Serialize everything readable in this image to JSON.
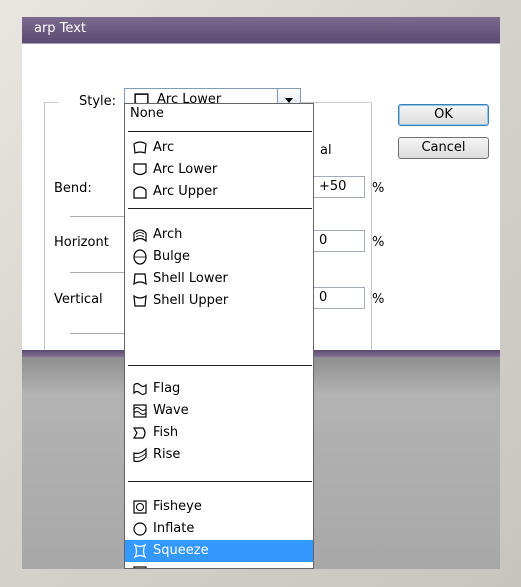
{
  "dialog": {
    "title": "arp Text",
    "style_label": "Style:",
    "style_value": "Arc Lower",
    "ok_label": "OK",
    "cancel_label": "Cancel",
    "radio_fragment": "(",
    "radio_fragment_right": "al",
    "bend_label": "Bend:",
    "bend_value": "+50",
    "horizontal_label": "Horizont",
    "horizontal_value": "0",
    "vertical_label": "Vertical",
    "vertical_value": "0",
    "percent": "%"
  },
  "dropdown": {
    "none_label": "None",
    "groups": [
      [
        {
          "label": "Arc",
          "icon": "arc-icon"
        },
        {
          "label": "Arc Lower",
          "icon": "arc-lower-icon"
        },
        {
          "label": "Arc Upper",
          "icon": "arc-upper-icon"
        }
      ],
      [
        {
          "label": "Arch",
          "icon": "arch-icon"
        },
        {
          "label": "Bulge",
          "icon": "bulge-icon"
        },
        {
          "label": "Shell Lower",
          "icon": "shell-lower-icon"
        },
        {
          "label": "Shell Upper",
          "icon": "shell-upper-icon"
        }
      ],
      [
        {
          "label": "Flag",
          "icon": "flag-icon"
        },
        {
          "label": "Wave",
          "icon": "wave-icon"
        },
        {
          "label": "Fish",
          "icon": "fish-icon"
        },
        {
          "label": "Rise",
          "icon": "rise-icon"
        }
      ],
      [
        {
          "label": "Fisheye",
          "icon": "fisheye-icon"
        },
        {
          "label": "Inflate",
          "icon": "inflate-icon"
        },
        {
          "label": "Squeeze",
          "icon": "squeeze-icon",
          "selected": true
        }
      ]
    ]
  },
  "colors": {
    "selection": "#3399ff",
    "title_bar": "#6b5b80"
  }
}
